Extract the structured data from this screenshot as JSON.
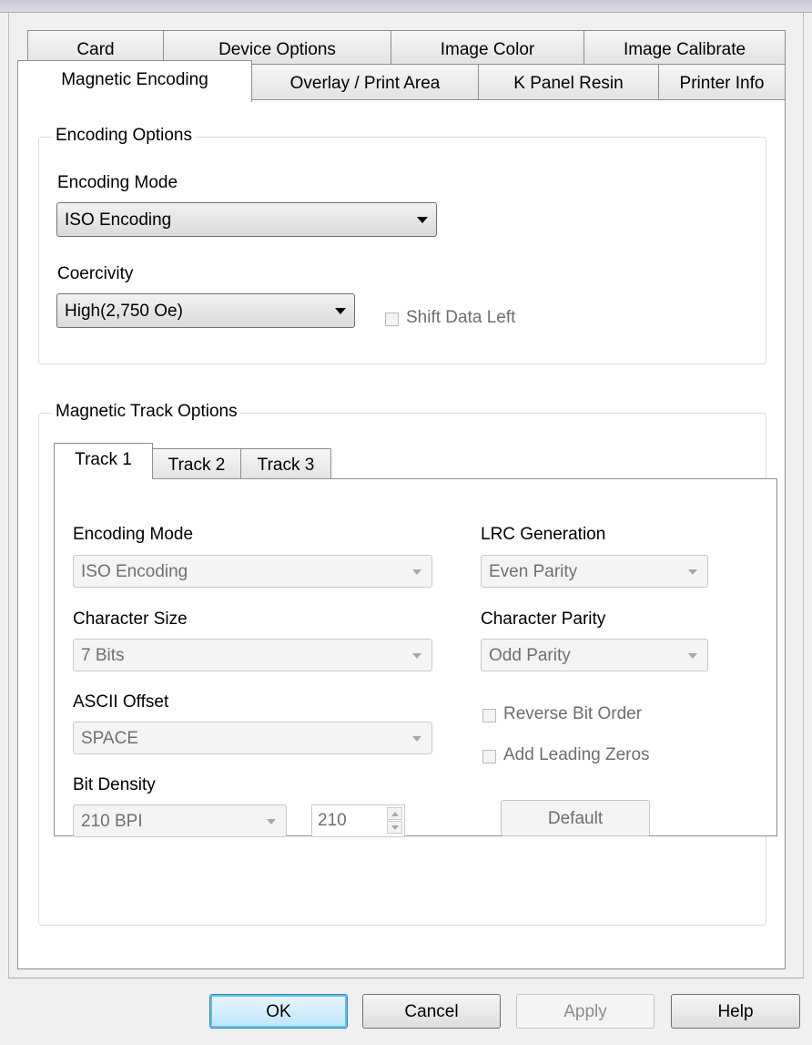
{
  "tabs_row1": [
    {
      "label": "Card"
    },
    {
      "label": "Device Options"
    },
    {
      "label": "Image Color"
    },
    {
      "label": "Image Calibrate"
    }
  ],
  "tabs_row2": [
    {
      "label": "Magnetic Encoding",
      "active": true
    },
    {
      "label": "Overlay / Print Area"
    },
    {
      "label": "K Panel Resin"
    },
    {
      "label": "Printer Info"
    }
  ],
  "encoding_options": {
    "title": "Encoding Options",
    "encoding_mode_label": "Encoding Mode",
    "encoding_mode_value": "ISO Encoding",
    "coercivity_label": "Coercivity",
    "coercivity_value": "High(2,750 Oe)",
    "shift_data_left_label": "Shift Data Left",
    "shift_data_left_checked": false
  },
  "track_options": {
    "title": "Magnetic Track Options",
    "tabs": [
      {
        "label": "Track 1",
        "active": true
      },
      {
        "label": "Track 2"
      },
      {
        "label": "Track 3"
      }
    ],
    "encoding_mode_label": "Encoding Mode",
    "encoding_mode_value": "ISO Encoding",
    "character_size_label": "Character Size",
    "character_size_value": "7 Bits",
    "ascii_offset_label": "ASCII Offset",
    "ascii_offset_value": "SPACE",
    "bit_density_label": "Bit Density",
    "bit_density_value": "210 BPI",
    "bit_density_number": "210",
    "lrc_generation_label": "LRC Generation",
    "lrc_generation_value": "Even Parity",
    "character_parity_label": "Character Parity",
    "character_parity_value": "Odd Parity",
    "reverse_bit_order_label": "Reverse Bit Order",
    "add_leading_zeros_label": "Add Leading Zeros",
    "default_button": "Default"
  },
  "footer": {
    "ok": "OK",
    "cancel": "Cancel",
    "apply": "Apply",
    "help": "Help"
  }
}
